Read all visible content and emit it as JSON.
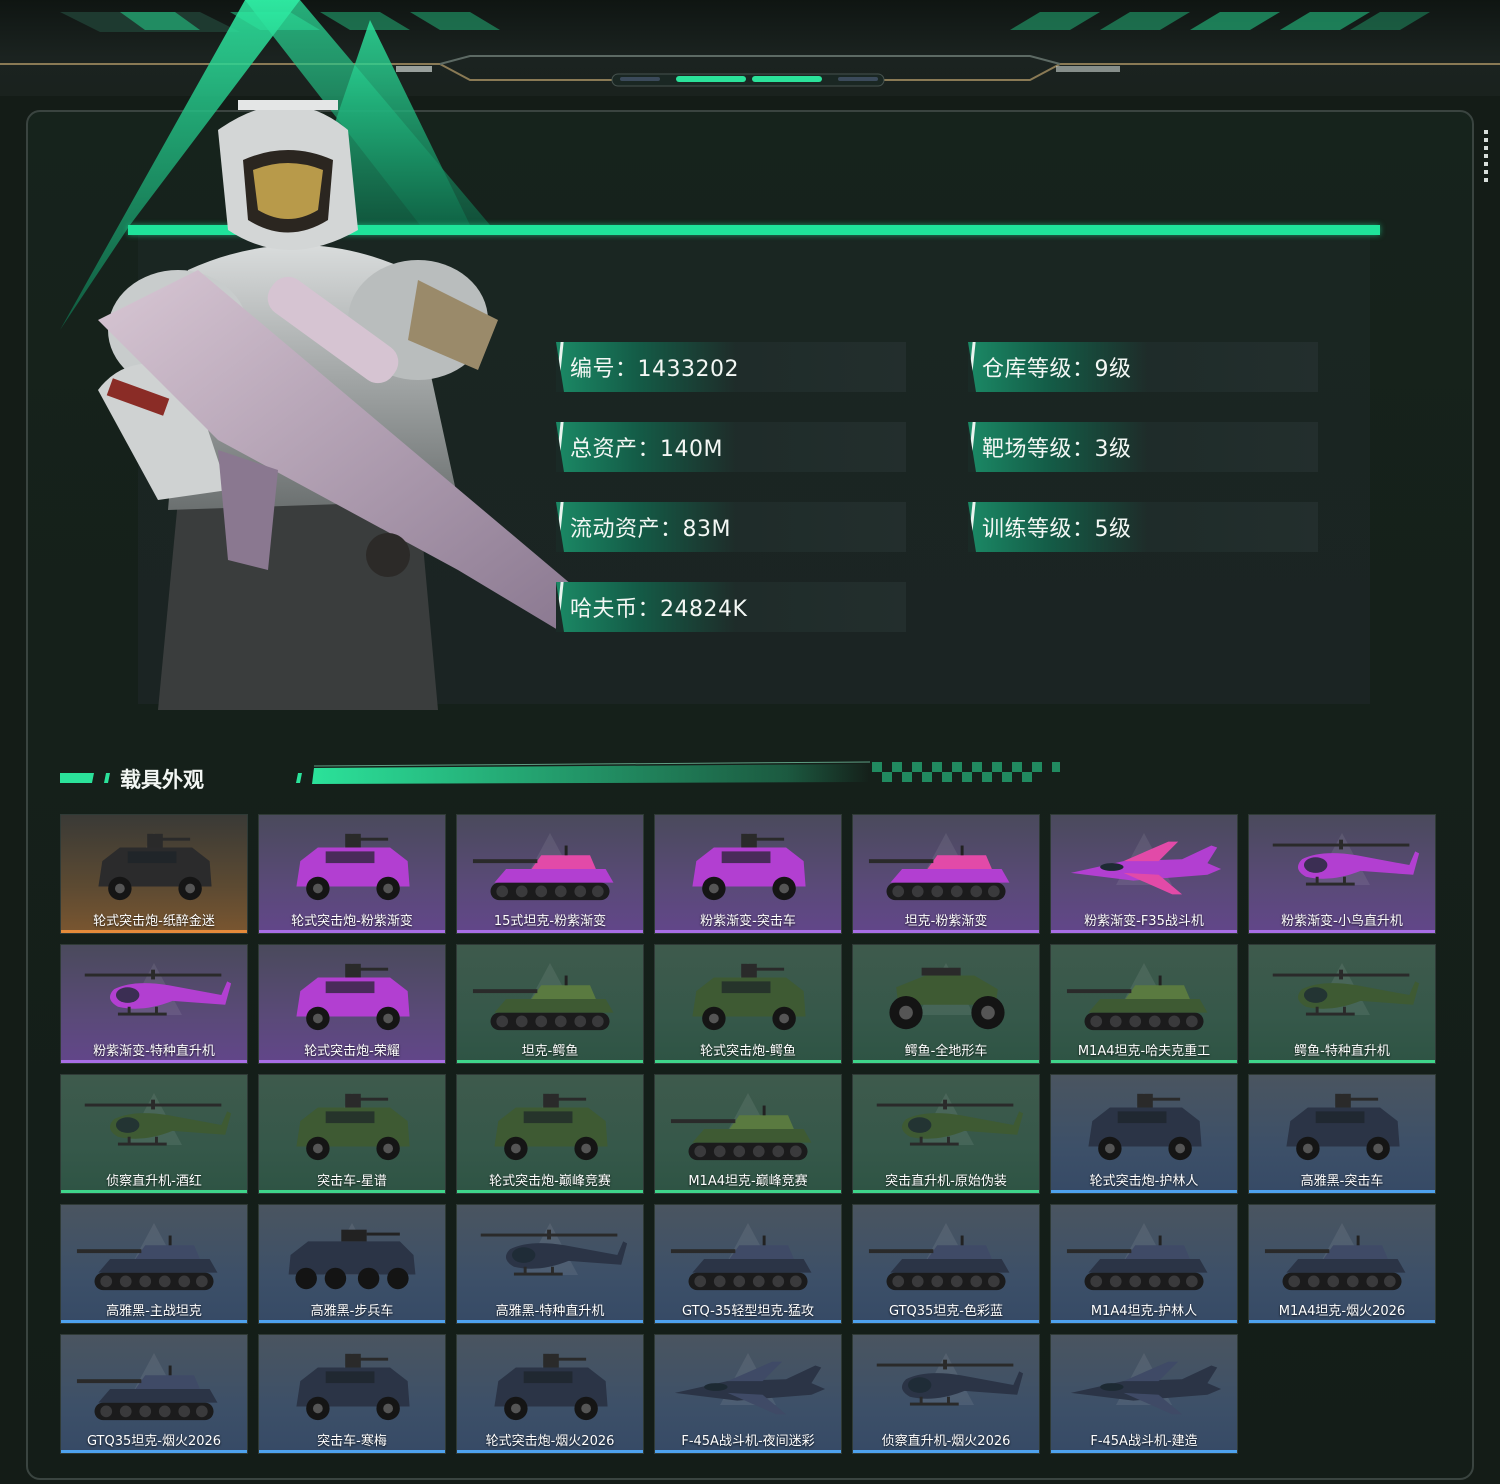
{
  "stats": {
    "id": "编号：1433202",
    "total_assets": "总资产：140M",
    "liquid_assets": "流动资产：83M",
    "havoc_coins": "哈夫币：24824K",
    "warehouse_level": "仓库等级：9级",
    "range_level": "靶场等级：3级",
    "training_level": "训练等级：5级"
  },
  "section": {
    "title": "载具外观"
  },
  "colors": {
    "accent": "#1fe39a",
    "orange": "#e48a3a",
    "purple": "#a86ee6",
    "green": "#3fd58a",
    "blue": "#4ea2ee"
  },
  "vehicles": [
    {
      "label": "轮式突击炮-纸醉金迷",
      "rarity": "orange",
      "kind": "truck"
    },
    {
      "label": "轮式突击炮-粉紫渐变",
      "rarity": "purple",
      "kind": "truck"
    },
    {
      "label": "15式坦克-粉紫渐变",
      "rarity": "purple",
      "kind": "tank"
    },
    {
      "label": "粉紫渐变-突击车",
      "rarity": "purple",
      "kind": "truck"
    },
    {
      "label": "坦克-粉紫渐变",
      "rarity": "purple",
      "kind": "tank"
    },
    {
      "label": "粉紫渐变-F35战斗机",
      "rarity": "purple",
      "kind": "jet"
    },
    {
      "label": "粉紫渐变-小鸟直升机",
      "rarity": "purple",
      "kind": "heli"
    },
    {
      "label": "粉紫渐变-特种直升机",
      "rarity": "purple",
      "kind": "heli"
    },
    {
      "label": "轮式突击炮-荣耀",
      "rarity": "purple",
      "kind": "truck"
    },
    {
      "label": "坦克-鳄鱼",
      "rarity": "green",
      "kind": "tank"
    },
    {
      "label": "轮式突击炮-鳄鱼",
      "rarity": "green",
      "kind": "truck"
    },
    {
      "label": "鳄鱼-全地形车",
      "rarity": "green",
      "kind": "atv"
    },
    {
      "label": "M1A4坦克-哈夫克重工",
      "rarity": "green",
      "kind": "tank"
    },
    {
      "label": "鳄鱼-特种直升机",
      "rarity": "green",
      "kind": "heli"
    },
    {
      "label": "侦察直升机-酒红",
      "rarity": "green",
      "kind": "heli"
    },
    {
      "label": "突击车-星谱",
      "rarity": "green",
      "kind": "truck"
    },
    {
      "label": "轮式突击炮-巅峰竞赛",
      "rarity": "green",
      "kind": "truck"
    },
    {
      "label": "M1A4坦克-巅峰竞赛",
      "rarity": "green",
      "kind": "tank"
    },
    {
      "label": "突击直升机-原始伪装",
      "rarity": "green",
      "kind": "heli"
    },
    {
      "label": "轮式突击炮-护林人",
      "rarity": "blue",
      "kind": "truck"
    },
    {
      "label": "高雅黑-突击车",
      "rarity": "blue",
      "kind": "truck"
    },
    {
      "label": "高雅黑-主战坦克",
      "rarity": "blue",
      "kind": "tank"
    },
    {
      "label": "高雅黑-步兵车",
      "rarity": "blue",
      "kind": "apc"
    },
    {
      "label": "高雅黑-特种直升机",
      "rarity": "blue",
      "kind": "heli"
    },
    {
      "label": "GTQ-35轻型坦克-猛攻",
      "rarity": "blue",
      "kind": "tank"
    },
    {
      "label": "GTQ35坦克-色彩蓝",
      "rarity": "blue",
      "kind": "tank"
    },
    {
      "label": "M1A4坦克-护林人",
      "rarity": "blue",
      "kind": "tank"
    },
    {
      "label": "M1A4坦克-烟火2026",
      "rarity": "blue",
      "kind": "tank"
    },
    {
      "label": "GTQ35坦克-烟火2026",
      "rarity": "blue",
      "kind": "tank"
    },
    {
      "label": "突击车-寒梅",
      "rarity": "blue",
      "kind": "truck"
    },
    {
      "label": "轮式突击炮-烟火2026",
      "rarity": "blue",
      "kind": "truck"
    },
    {
      "label": "F-45A战斗机-夜间迷彩",
      "rarity": "blue",
      "kind": "jet"
    },
    {
      "label": "侦察直升机-烟火2026",
      "rarity": "blue",
      "kind": "heli"
    },
    {
      "label": "F-45A战斗机-建造",
      "rarity": "blue",
      "kind": "jet"
    }
  ]
}
